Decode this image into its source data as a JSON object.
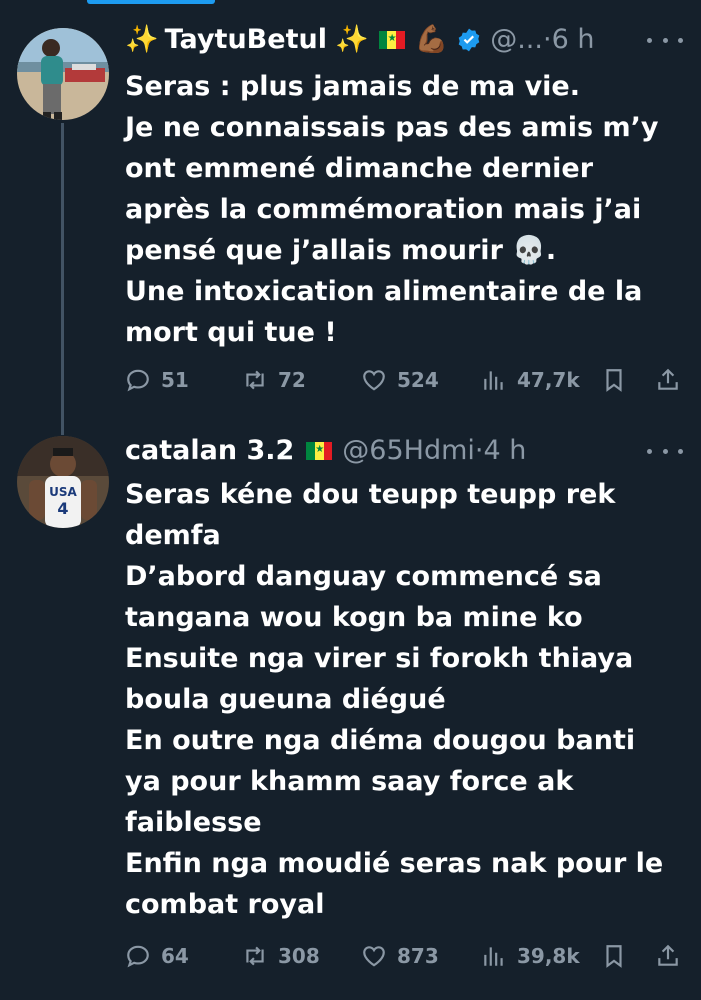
{
  "tweets": [
    {
      "name": "TaytuBetul",
      "handle": "@...",
      "time": "6 h",
      "lines": [
        "Seras : plus jamais de ma vie.",
        "Je ne connaissais pas des amis m’y",
        "ont emmené dimanche dernier",
        "après la commémoration mais j’ai",
        "pensé que j’allais mourir 💀.",
        "Une intoxication alimentaire de la",
        "mort qui tue !"
      ],
      "replies": "51",
      "retweets": "72",
      "likes": "524",
      "views": "47,7k"
    },
    {
      "name": "catalan 3.2",
      "handle": "@65Hdmi",
      "time": "4 h",
      "lines": [
        "Seras kéne dou teupp teupp rek",
        "demfa",
        "D’abord danguay commencé sa",
        "tangana wou kogn ba mine ko",
        "Ensuite nga virer si forokh thiaya",
        "boula gueuna diégué",
        "En outre nga diéma dougou banti",
        "ya pour khamm saay force ak",
        "faiblesse",
        "Enfin nga moudié seras nak pour le",
        "combat royal"
      ],
      "replies": "64",
      "retweets": "308",
      "likes": "873",
      "views": "39,8k"
    }
  ],
  "separator": "·",
  "colors": {
    "background": "#15202b",
    "text": "#ffffff",
    "muted": "#8b98a5",
    "accent": "#1d9bf0",
    "thread_line": "#425364"
  },
  "icons": [
    "sparkles-icon",
    "senegal-flag-icon",
    "flexed-biceps-icon",
    "verified-badge-icon",
    "more-icon",
    "reply-icon",
    "retweet-icon",
    "like-icon",
    "views-icon",
    "bookmark-icon",
    "share-icon"
  ]
}
